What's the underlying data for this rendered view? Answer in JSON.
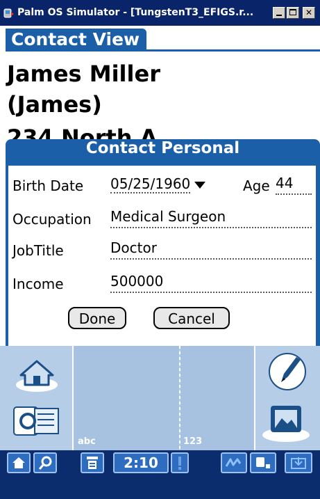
{
  "window": {
    "title": "Palm OS Simulator - [TungstenT3_EFIGS.r...",
    "buttons": [
      "minimize-icon",
      "maximize-icon",
      "close-icon"
    ]
  },
  "form": {
    "title": "Contact View",
    "contact_name": "James Miller",
    "contact_nickname": "(James)",
    "contact_address_partial": "234 North A..."
  },
  "dialog": {
    "title": "Contact Personal",
    "birth_date_label": "Birth Date",
    "birth_date_value": "05/25/1960",
    "age_label": "Age",
    "age_value": "44",
    "occupation_label": "Occupation",
    "occupation_value": "Medical Surgeon",
    "jobtitle_label": "JobTitle",
    "jobtitle_value": "Doctor",
    "income_label": "Income",
    "income_value": "500000",
    "done_label": "Done",
    "cancel_label": "Cancel"
  },
  "graffiti": {
    "left_label": "abc",
    "right_label": "123",
    "icons": [
      "home-icon",
      "find-icon",
      "pen-icon",
      "display-icon"
    ]
  },
  "statusbar": {
    "time": "2:10",
    "icons": [
      "home-icon",
      "find-icon",
      "menu-icon",
      "alert-icon",
      "graffiti-icon",
      "screen-icon",
      "input-icon"
    ]
  },
  "colors": {
    "title_bar": "#0a246a",
    "palm_blue": "#1a5fa8",
    "graffiti_bg": "#b5cde6",
    "status_bg": "#0b2d6e"
  }
}
